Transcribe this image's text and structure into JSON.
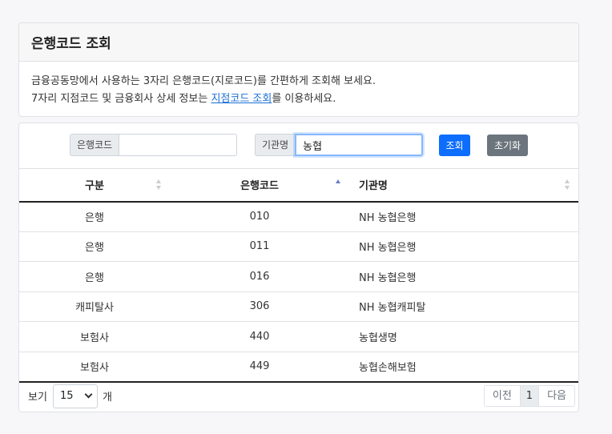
{
  "info": {
    "title": "은행코드 조회",
    "line1": "금융공동망에서 사용하는 3자리 은행코드(지로코드)를 간편하게 조회해 보세요.",
    "line2_before": "7자리 지점코드 및 금융회사 상세 정보는 ",
    "line2_link": "지점코드 조회",
    "line2_after": "를 이용하세요."
  },
  "search": {
    "bank_code_label": "은행코드",
    "bank_code_value": "",
    "org_name_label": "기관명",
    "org_name_value": "농협",
    "search_button": "조회",
    "reset_button": "초기화"
  },
  "table": {
    "headers": [
      "구분",
      "은행코드",
      "기관명"
    ],
    "sorted_column": "은행코드",
    "rows": [
      [
        "은행",
        "010",
        "NH 농협은행"
      ],
      [
        "은행",
        "011",
        "NH 농협은행"
      ],
      [
        "은행",
        "016",
        "NH 농협은행"
      ],
      [
        "캐피탈사",
        "306",
        "NH 농협캐피탈"
      ],
      [
        "보험사",
        "440",
        "농협생명"
      ],
      [
        "보험사",
        "449",
        "농협손해보험"
      ]
    ]
  },
  "footer": {
    "view_label": "보기",
    "page_size": "15",
    "unit_label": "개",
    "prev": "이전",
    "current_page": "1",
    "next": "다음"
  },
  "colors": {
    "primary": "#0d6efd",
    "secondary": "#6c757d",
    "link": "#1a6fd4"
  }
}
